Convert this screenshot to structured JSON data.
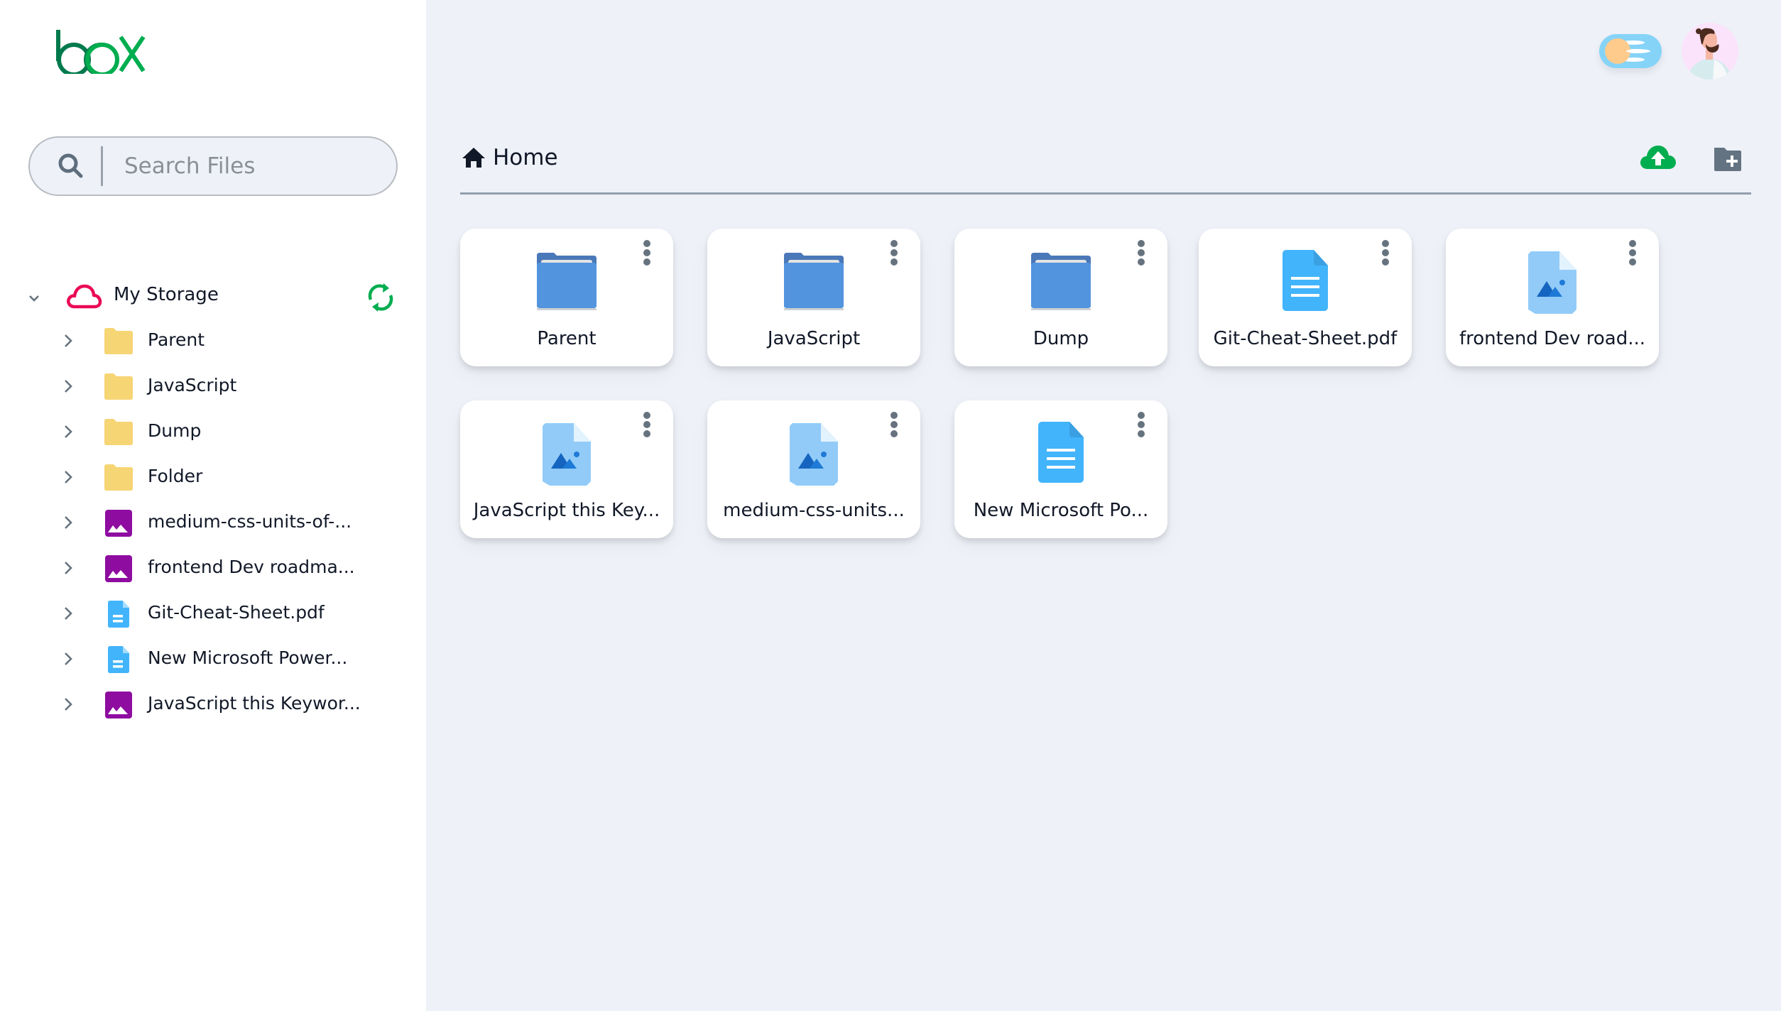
{
  "app": {
    "logo_text": "box",
    "colors": {
      "logo_dark": "#007a4d",
      "logo_light": "#00ad4f",
      "cloud_accent": "#ea0a55",
      "sync_green": "#00ad4f",
      "folder_yellow": "#f6d574",
      "image_purple": "#8e0ca0",
      "doc_blue": "#42b4fb",
      "folder_blue": "#5394df",
      "image_light_blue": "#92cbf8",
      "upload_green": "#00ad4f",
      "new_folder_gray": "#637381"
    }
  },
  "search": {
    "placeholder": "Search Files",
    "value": ""
  },
  "sidebar": {
    "root_label": "My Storage",
    "items": [
      {
        "label": "Parent",
        "type": "folder"
      },
      {
        "label": "JavaScript",
        "type": "folder"
      },
      {
        "label": "Dump",
        "type": "folder"
      },
      {
        "label": "Folder",
        "type": "folder"
      },
      {
        "label": "medium-css-units-of-...",
        "type": "image"
      },
      {
        "label": "frontend Dev roadma...",
        "type": "image"
      },
      {
        "label": "Git-Cheat-Sheet.pdf",
        "type": "document"
      },
      {
        "label": "New Microsoft Power...",
        "type": "document"
      },
      {
        "label": "JavaScript this Keywor...",
        "type": "image"
      }
    ]
  },
  "header": {
    "theme_toggle": "dark-mode-toggle",
    "avatar": "user-avatar"
  },
  "main": {
    "breadcrumb": "Home",
    "actions": {
      "upload": "upload-icon",
      "new_folder": "new-folder-icon"
    },
    "cards": [
      {
        "name": "Parent",
        "type": "folder"
      },
      {
        "name": "JavaScript",
        "type": "folder"
      },
      {
        "name": "Dump",
        "type": "folder"
      },
      {
        "name": "Git-Cheat-Sheet.pdf",
        "type": "document"
      },
      {
        "name": "frontend Dev road...",
        "type": "image"
      },
      {
        "name": "JavaScript this Key...",
        "type": "image"
      },
      {
        "name": "medium-css-units...",
        "type": "image"
      },
      {
        "name": "New Microsoft Po...",
        "type": "document"
      }
    ]
  }
}
